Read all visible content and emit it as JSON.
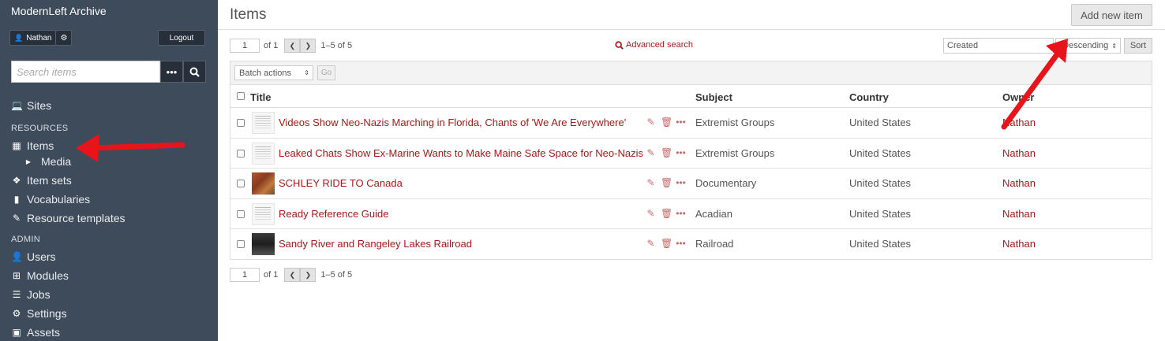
{
  "site": {
    "title": "ModernLeft Archive"
  },
  "user": {
    "name": "Nathan",
    "logout_label": "Logout"
  },
  "search": {
    "placeholder": "Search items"
  },
  "nav": {
    "sites_label": "Sites",
    "resources_heading": "RESOURCES",
    "items_label": "Items",
    "media_label": "Media",
    "item_sets_label": "Item sets",
    "vocabularies_label": "Vocabularies",
    "resource_templates_label": "Resource templates",
    "admin_heading": "ADMIN",
    "users_label": "Users",
    "modules_label": "Modules",
    "jobs_label": "Jobs",
    "settings_label": "Settings",
    "assets_label": "Assets"
  },
  "main": {
    "title": "Items",
    "add_new_label": "Add new item",
    "advanced_search_label": "Advanced search",
    "sort_by": "Created",
    "sort_order": "Descending",
    "sort_label": "Sort",
    "batch_actions_label": "Batch actions",
    "go_label": "Go"
  },
  "pagination": {
    "page": "1",
    "of_label": "of 1",
    "range_label": "1–5 of 5"
  },
  "table": {
    "headers": {
      "title": "Title",
      "subject": "Subject",
      "country": "Country",
      "owner": "Owner"
    },
    "rows": [
      {
        "title": "Videos Show Neo-Nazis Marching in Florida, Chants of 'We Are Everywhere'",
        "subject": "Extremist Groups",
        "country": "United States",
        "owner": "Nathan"
      },
      {
        "title": "Leaked Chats Show Ex-Marine Wants to Make Maine Safe Space for Neo-Nazis",
        "subject": "Extremist Groups",
        "country": "United States",
        "owner": "Nathan"
      },
      {
        "title": "SCHLEY RIDE TO Canada",
        "subject": "Documentary",
        "country": "United States",
        "owner": "Nathan"
      },
      {
        "title": "Ready Reference Guide",
        "subject": "Acadian",
        "country": "United States",
        "owner": "Nathan"
      },
      {
        "title": "Sandy River and Rangeley Lakes Railroad",
        "subject": "Railroad",
        "country": "United States",
        "owner": "Nathan"
      }
    ]
  },
  "colors": {
    "sidebar": "#3e4b5b",
    "link": "#a91919",
    "annotation": "#e8141b"
  }
}
